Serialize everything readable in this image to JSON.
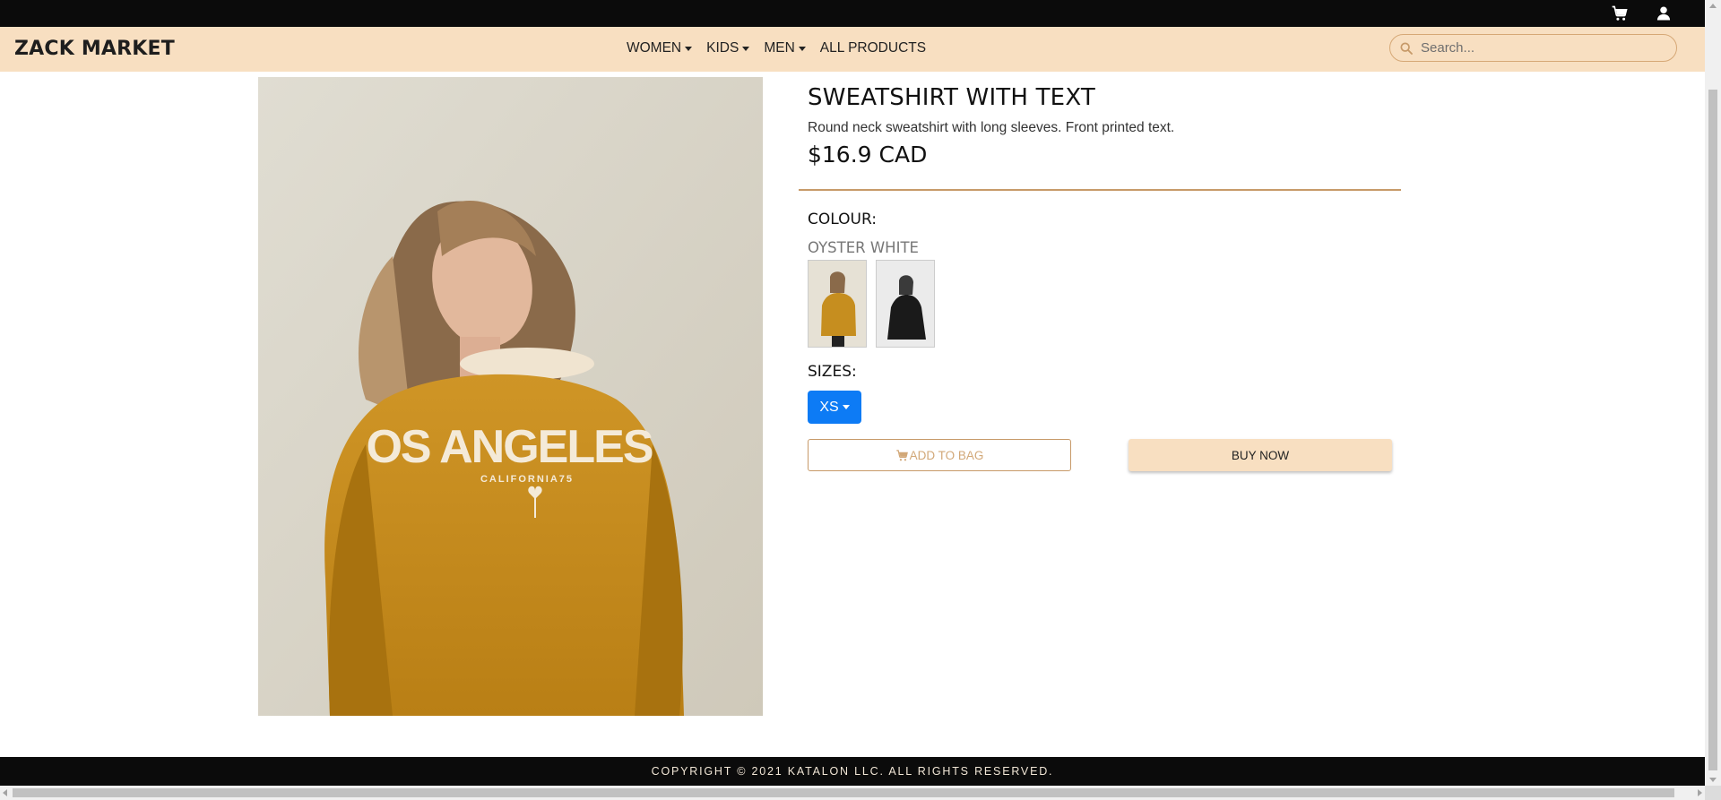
{
  "topbar": {
    "cart_icon": "shopping-cart-icon",
    "user_icon": "user-icon"
  },
  "navbar": {
    "brand": "ZACK MARKET",
    "menu": [
      {
        "label": "WOMEN",
        "dropdown": true
      },
      {
        "label": "KIDS",
        "dropdown": true
      },
      {
        "label": "MEN",
        "dropdown": true
      },
      {
        "label": "ALL PRODUCTS",
        "dropdown": false
      }
    ],
    "search": {
      "placeholder": "Search...",
      "value": ""
    }
  },
  "product": {
    "title": "SWEATSHIRT WITH TEXT",
    "description": "Round neck sweatshirt with long sleeves. Front printed text.",
    "price": "$16.9 CAD",
    "image_text": "OS ANGELES",
    "image_subtext": "CALIFORNIA75",
    "colour_label": "COLOUR:",
    "colour_name": "OYSTER WHITE",
    "sizes_label": "SIZES:",
    "size_selected": "XS",
    "add_to_bag": "ADD TO BAG",
    "buy_now": "BUY NOW"
  },
  "footer": {
    "copyright": "COPYRIGHT © 2021 KATALON LLC. ALL RIGHTS RESERVED."
  },
  "colors": {
    "nav_bg": "#f8dfc1",
    "topbar_bg": "#0b0b0b",
    "accent": "#c79a69",
    "size_button": "#0d7bf5",
    "sweatshirt": "#c68e1f"
  }
}
